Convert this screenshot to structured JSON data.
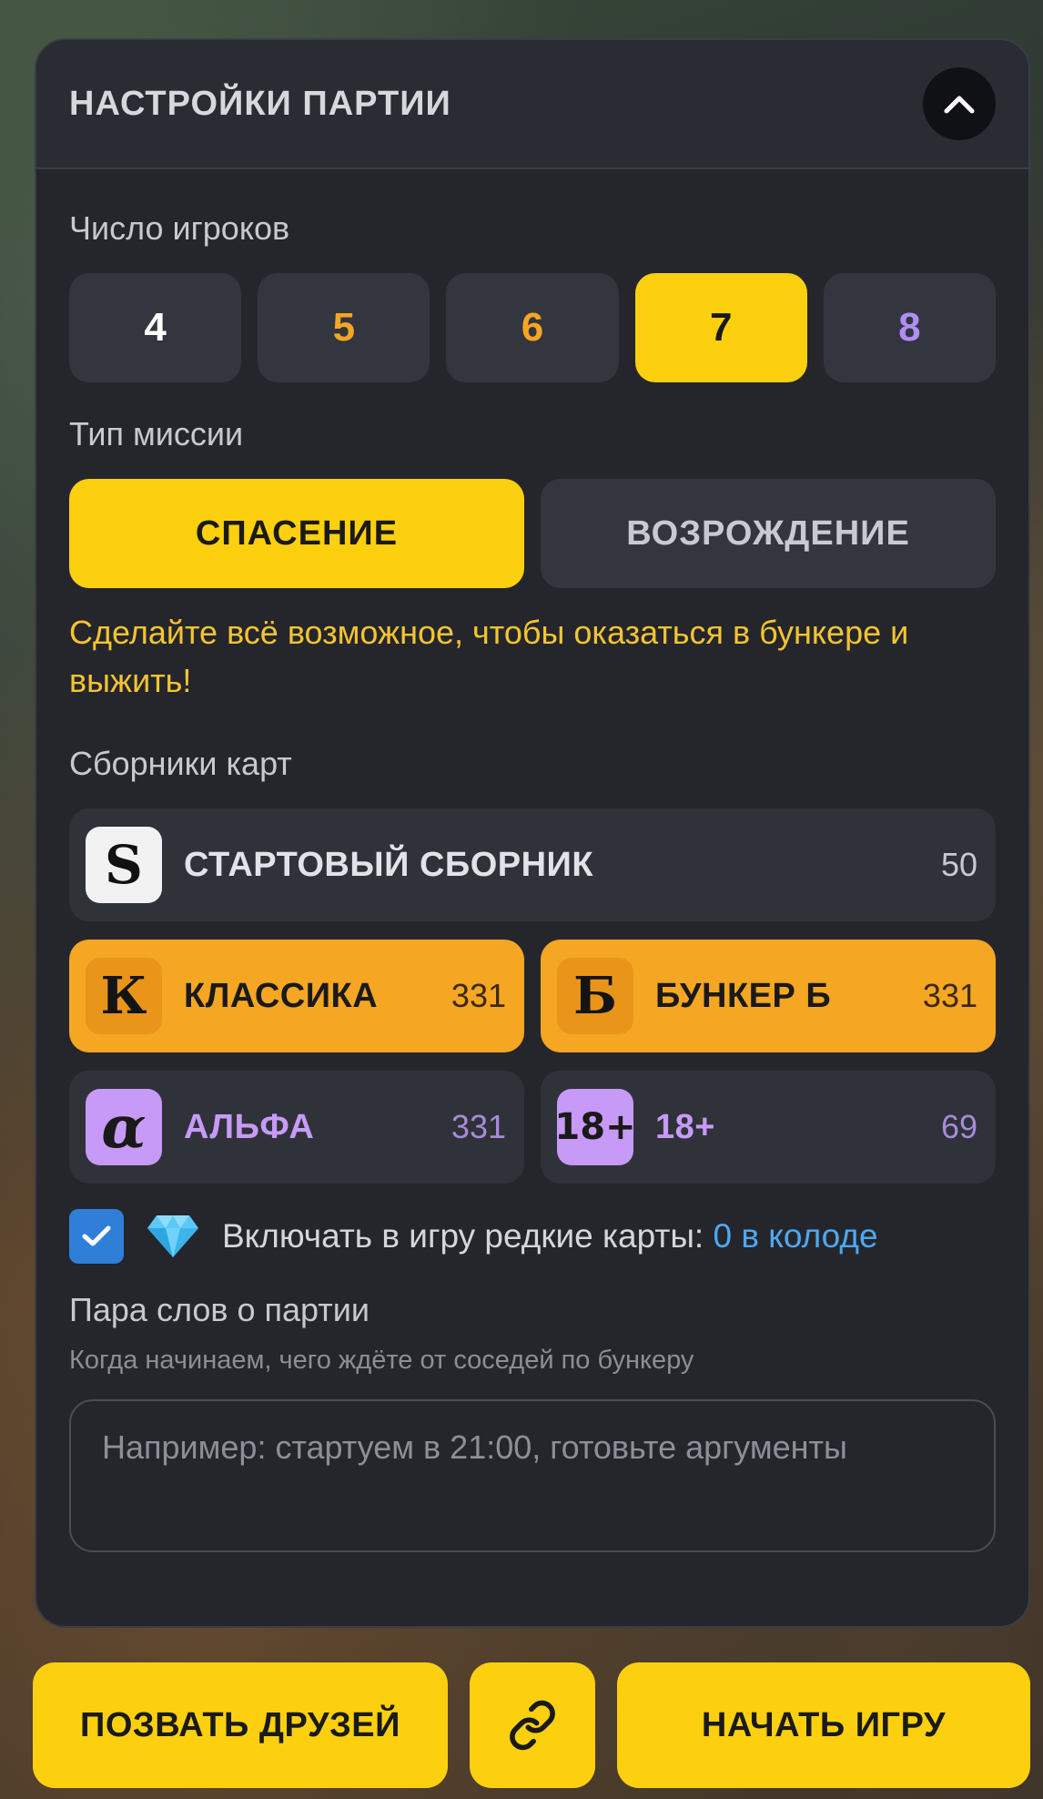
{
  "header": {
    "title": "НАСТРОЙКИ ПАРТИИ",
    "collapse_icon": "chevron-up-icon"
  },
  "players": {
    "label": "Число игроков",
    "options": [
      {
        "value": "4",
        "color": "#ffffff"
      },
      {
        "value": "5",
        "color": "#f5a623"
      },
      {
        "value": "6",
        "color": "#f5a623"
      },
      {
        "value": "7",
        "color": "#1a1a1a"
      },
      {
        "value": "8",
        "color": "#b28cf5"
      }
    ],
    "selected": "7"
  },
  "mission": {
    "label": "Тип миссии",
    "options": [
      "СПАСЕНИЕ",
      "ВОЗРОЖДЕНИЕ"
    ],
    "selected": "СПАСЕНИЕ",
    "description": "Сделайте всё возможное, чтобы оказаться в бункере и выжить!"
  },
  "packs": {
    "label": "Сборники карт",
    "starter": {
      "icon_letter": "S",
      "name": "СТАРТОВЫЙ СБОРНИК",
      "count": "50"
    },
    "classic": {
      "icon_letter": "К",
      "name": "КЛАССИКА",
      "count": "331"
    },
    "bunker_b": {
      "icon_letter": "Б",
      "name": "БУНКЕР Б",
      "count": "331"
    },
    "alpha": {
      "icon_letter": "α",
      "name": "АЛЬФА",
      "count": "331"
    },
    "adult": {
      "icon_letter": "18+",
      "name": "18+",
      "count": "69"
    }
  },
  "rare": {
    "checked": true,
    "label": "Включать в игру редкие карты: ",
    "link": "0 в колоде"
  },
  "about": {
    "title": "Пара слов о партии",
    "subtitle": "Когда начинаем, чего ждёте от соседей по бункеру",
    "placeholder": "Например: стартуем в 21:00, готовьте аргументы"
  },
  "actions": {
    "invite": "ПОЗВАТЬ ДРУЗЕЙ",
    "link_icon": "link-icon",
    "start": "НАЧАТЬ ИГРУ"
  },
  "colors": {
    "accent_yellow": "#fcd00f",
    "accent_orange": "#f5a623",
    "purple": "#b28cf5",
    "link_blue": "#4fa8f0"
  }
}
